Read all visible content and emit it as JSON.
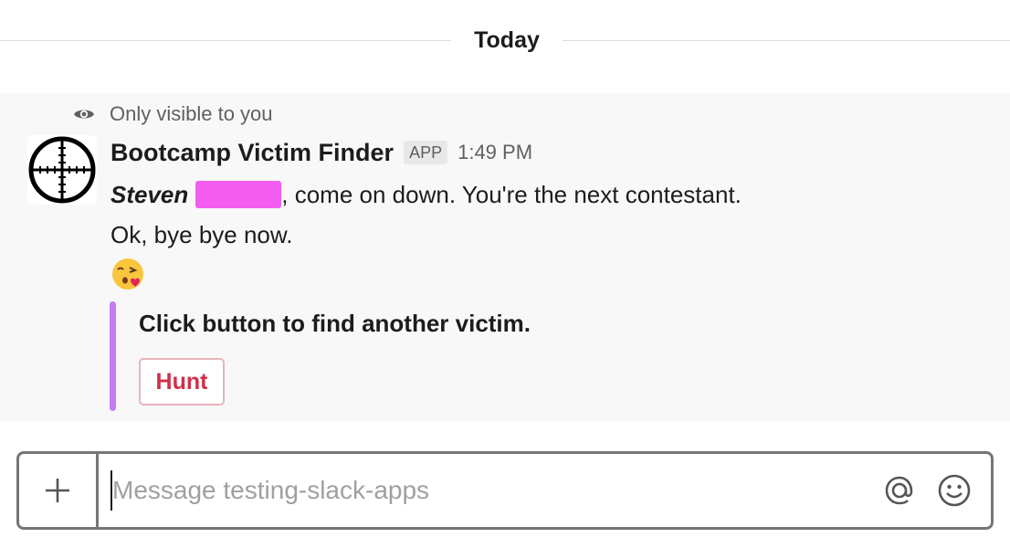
{
  "divider": {
    "label": "Today"
  },
  "message": {
    "visibility_note": "Only visible to you",
    "visibility_icon": "eye-icon",
    "avatar_icon": "crosshair-icon",
    "sender": "Bootcamp Victim Finder",
    "badge": "APP",
    "time": "1:49 PM",
    "line1": {
      "name": "Steven",
      "rest": ", come on down. You're the next contestant."
    },
    "line2": "Ok, bye bye now.",
    "emoji": "face-blowing-kiss-emoji",
    "attachment": {
      "text": "Click button to find another victim.",
      "button_label": "Hunt",
      "bar_color": "#c67af6",
      "button_color": "#d0304a"
    }
  },
  "composer": {
    "placeholder": "Message testing-slack-apps",
    "add_icon": "plus-icon",
    "mention_icon": "at-sign-icon",
    "emoji_icon": "smiley-icon"
  }
}
